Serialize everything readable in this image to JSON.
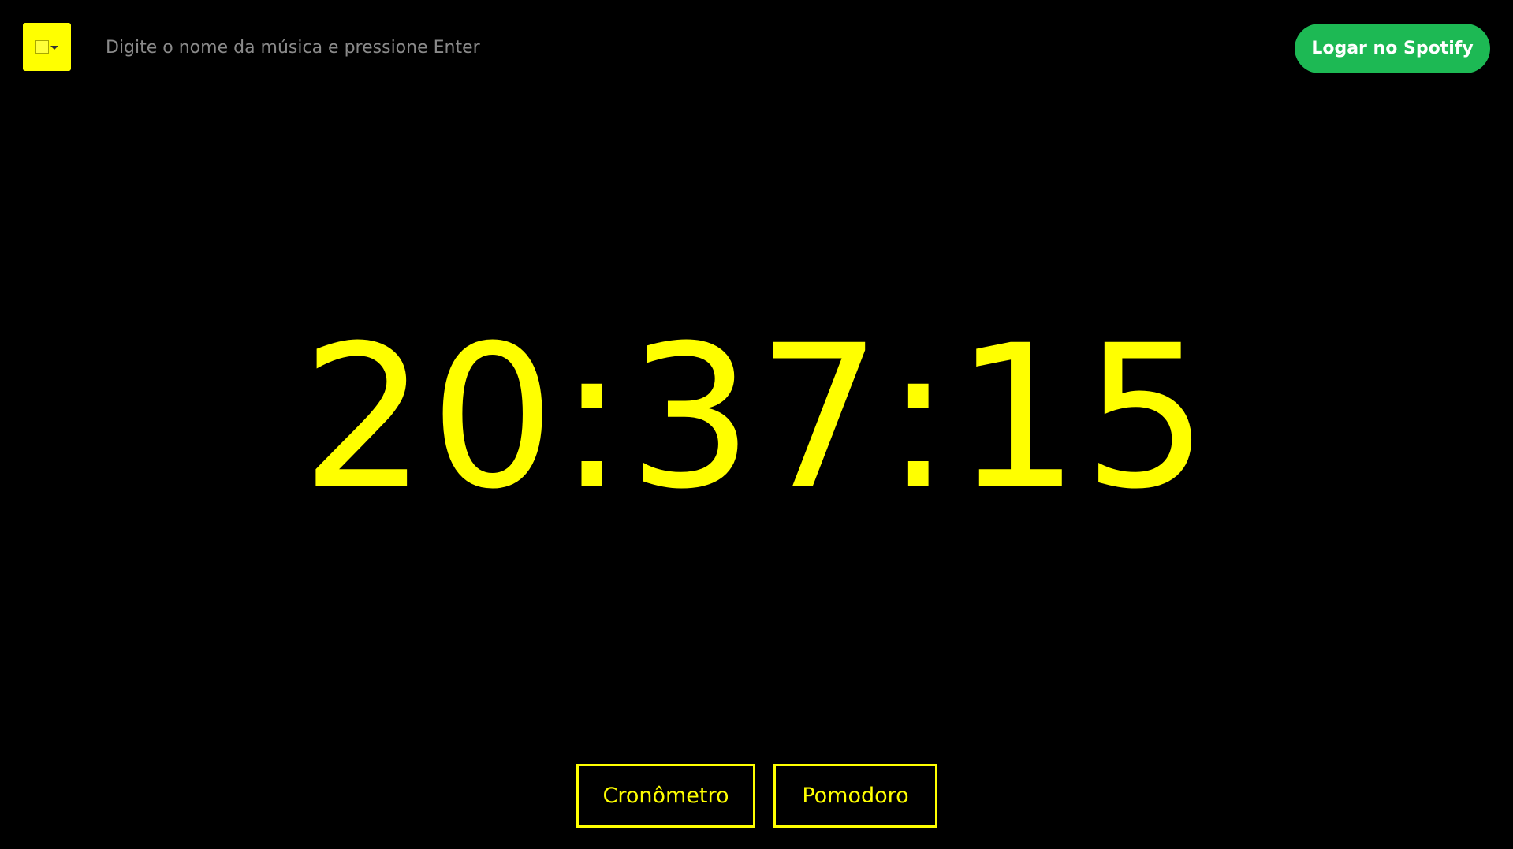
{
  "header": {
    "color_picker": {
      "icon": "color-swatch-dropdown-icon",
      "color": "#ffff00"
    },
    "search": {
      "placeholder": "Digite o nome da música e pressione Enter",
      "value": ""
    },
    "spotify_login_label": "Logar no Spotify",
    "spotify_color": "#1db954"
  },
  "clock": {
    "time": "20:37:15",
    "color": "#ffff00"
  },
  "modes": {
    "stopwatch_label": "Cronômetro",
    "pomodoro_label": "Pomodoro"
  }
}
